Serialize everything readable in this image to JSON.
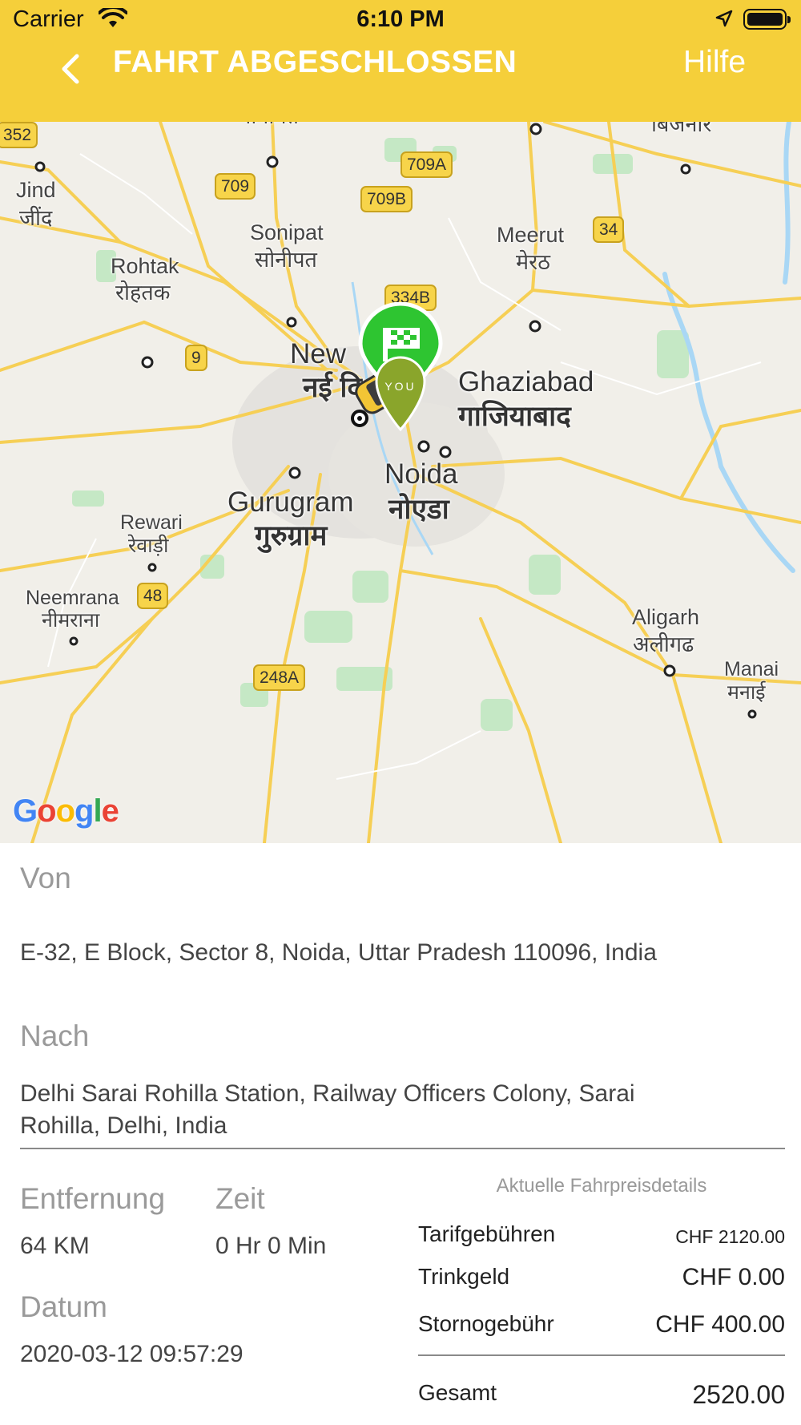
{
  "status_bar": {
    "carrier": "Carrier",
    "time": "6:10 PM"
  },
  "nav": {
    "title": "FAHRT ABGESCHLOSSEN",
    "help": "Hilfe"
  },
  "map": {
    "labels": {
      "panipat": "पानीपत",
      "bijnor": "बिजनौर",
      "jind_en": "Jind",
      "jind_hi": "जींद",
      "sonipat_en": "Sonipat",
      "sonipat_hi": "सोनीपत",
      "meerut_en": "Meerut",
      "meerut_hi": "मेरठ",
      "rohtak_en": "Rohtak",
      "rohtak_hi": "रोहतक",
      "newdelhi_en": "New",
      "newdelhi_hi": "नई दि",
      "ghaziabad_en": "Ghaziabad",
      "ghaziabad_hi": "गाजियाबाद",
      "noida_en": "Noida",
      "noida_hi": "नोएडा",
      "gurugram_en": "Gurugram",
      "gurugram_hi": "गुरुग्राम",
      "rewari_en": "Rewari",
      "rewari_hi": "रेवाड़ी",
      "neemrana_en": "Neemrana",
      "neemrana_hi": "नीमराना",
      "aligarh_en": "Aligarh",
      "aligarh_hi": "अलीगढ",
      "manai_en": "Manai",
      "manai_hi": "मनाई"
    },
    "shields": {
      "s352": "352",
      "s709": "709",
      "s709a": "709A",
      "s709b": "709B",
      "s34": "34",
      "s334b": "334B",
      "s9": "9",
      "s48": "48",
      "s248a": "248A"
    },
    "you_pin": "YOU",
    "attribution": "Google",
    "colors": {
      "road": "#f6cf55",
      "water": "#a9d7f5",
      "park": "#c5e8c5",
      "pin_green": "#2ec531",
      "pin_olive": "#8aa52b"
    }
  },
  "trip": {
    "from_label": "Von",
    "from_value": "E-32, E Block, Sector 8, Noida, Uttar Pradesh 110096, India",
    "to_label": "Nach",
    "to_value_line1": "Delhi Sarai Rohilla Station, Railway Officers Colony, Sarai",
    "to_value_line2": "Rohilla, Delhi, India",
    "distance_label": "Entfernung",
    "distance_value": "64 KM",
    "time_label": "Zeit",
    "time_value": "0 Hr 0 Min",
    "date_label": "Datum",
    "date_value": "2020-03-12 09:57:29"
  },
  "fare": {
    "title": "Aktuelle Fahrpreisdetails",
    "rows": [
      {
        "label": "Tarifgebühren",
        "value": "CHF 2120.00"
      },
      {
        "label": "Trinkgeld",
        "value": "CHF 0.00"
      },
      {
        "label": "Stornogebühr",
        "value": "CHF 400.00"
      }
    ],
    "total_label": "Gesamt",
    "total_value": "2520.00"
  }
}
